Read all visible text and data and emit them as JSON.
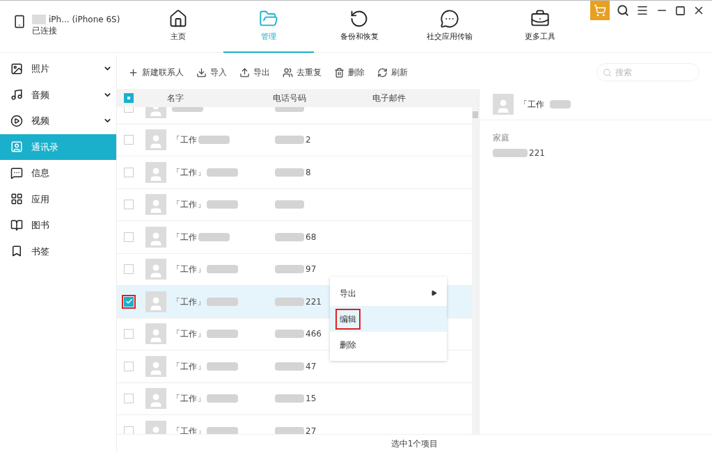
{
  "device": {
    "name": "iPh... (iPhone 6S)",
    "status": "已连接"
  },
  "nav_tabs": [
    {
      "label": "主页",
      "selected": false
    },
    {
      "label": "管理",
      "selected": true
    },
    {
      "label": "备份和恢复",
      "selected": false
    },
    {
      "label": "社交应用传输",
      "selected": false
    },
    {
      "label": "更多工具",
      "selected": false
    }
  ],
  "sidebar": {
    "items": [
      {
        "label": "照片",
        "expandable": true,
        "selected": false
      },
      {
        "label": "音频",
        "expandable": true,
        "selected": false
      },
      {
        "label": "视频",
        "expandable": true,
        "selected": false
      },
      {
        "label": "通讯录",
        "expandable": false,
        "selected": true
      },
      {
        "label": "信息",
        "expandable": false,
        "selected": false
      },
      {
        "label": "应用",
        "expandable": false,
        "selected": false
      },
      {
        "label": "图书",
        "expandable": false,
        "selected": false
      },
      {
        "label": "书签",
        "expandable": false,
        "selected": false
      }
    ]
  },
  "toolbar": [
    "新建联系人",
    "导入",
    "导出",
    "去重复",
    "删除",
    "刷新"
  ],
  "search": {
    "placeholder": "搜索"
  },
  "table": {
    "columns": [
      "名字",
      "电话号码",
      "电子邮件"
    ],
    "select_all_partial": true,
    "rows": [
      {
        "checked": false,
        "selected": false
      },
      {
        "name": "「工作",
        "phone": "2",
        "checked": false,
        "selected": false
      },
      {
        "name": "「工作」",
        "phone": "8",
        "checked": false,
        "selected": false
      },
      {
        "name": "「工作」",
        "checked": false,
        "selected": false
      },
      {
        "name": "「工作",
        "phone": "68",
        "checked": false,
        "selected": false
      },
      {
        "name": "「工作」",
        "phone": "97",
        "checked": false,
        "selected": false
      },
      {
        "name": "「工作」",
        "phone": "221",
        "checked": true,
        "selected": true
      },
      {
        "name": "「工作」",
        "phone": "466",
        "checked": false,
        "selected": false
      },
      {
        "name": "「工作」",
        "phone": "47",
        "checked": false,
        "selected": false
      },
      {
        "name": "「工作」",
        "phone": "15",
        "checked": false,
        "selected": false
      },
      {
        "name": "「工作」",
        "phone": "27",
        "checked": false,
        "selected": false
      }
    ]
  },
  "context_menu": [
    {
      "label": "导出",
      "submenu": true,
      "highlighted": false
    },
    {
      "label": "编辑",
      "submenu": false,
      "highlighted": true
    },
    {
      "label": "删除",
      "submenu": false,
      "highlighted": false
    }
  ],
  "detail": {
    "name": "「工作",
    "field_label": "家庭",
    "phone": "221"
  },
  "status_bar": "选中1个项目"
}
